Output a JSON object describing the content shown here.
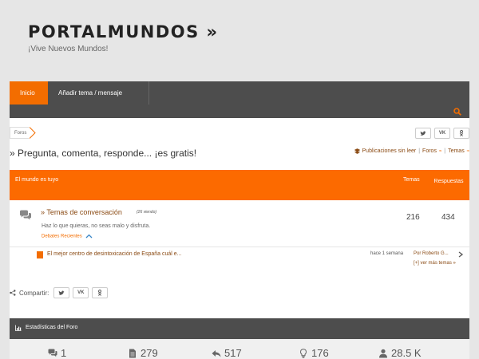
{
  "site": {
    "title": "PORTALMUNDOS »",
    "tagline": "¡Vive Nuevos Mundos!"
  },
  "nav": {
    "items": [
      {
        "label": "Inicio",
        "active": true
      },
      {
        "label": "Añadir tema / mensaje",
        "active": false
      }
    ]
  },
  "breadcrumb": {
    "label": "Foros"
  },
  "forum": {
    "title": "» Pregunta, comenta, responde... ¡es gratis!",
    "links": {
      "unread": "Publicaciones sin leer",
      "forums": "Foros",
      "topics": "Temas"
    }
  },
  "category": {
    "title": "El mundo es tuyo",
    "col_topics": "Temas",
    "col_replies": "Respuestas"
  },
  "subforum": {
    "link": "» Temas de conversación",
    "views": "(26 viendo)",
    "description": "Haz lo que quieras, no seas malo y disfruta.",
    "debates": "Debates Recientes",
    "topics": "216",
    "replies": "434"
  },
  "last_post": {
    "title": "El mejor centro de desintoxicación de España cuál e...",
    "time": "hace 1 semana",
    "author": "Por Roberto G...",
    "more": "[+] ver más temas »"
  },
  "share": {
    "label": "Compartir:"
  },
  "stats": {
    "title": "Estadísticas del Foro",
    "items": [
      {
        "icon": "comments-icon",
        "value": "1"
      },
      {
        "icon": "document-icon",
        "value": "279"
      },
      {
        "icon": "reply-icon",
        "value": "517"
      },
      {
        "icon": "lightbulb-icon",
        "value": "176"
      },
      {
        "icon": "user-icon",
        "value": "28.5 K"
      }
    ]
  },
  "colors": {
    "accent": "#f36d00",
    "nav": "#4d4d4d",
    "link": "#8a4a13"
  }
}
